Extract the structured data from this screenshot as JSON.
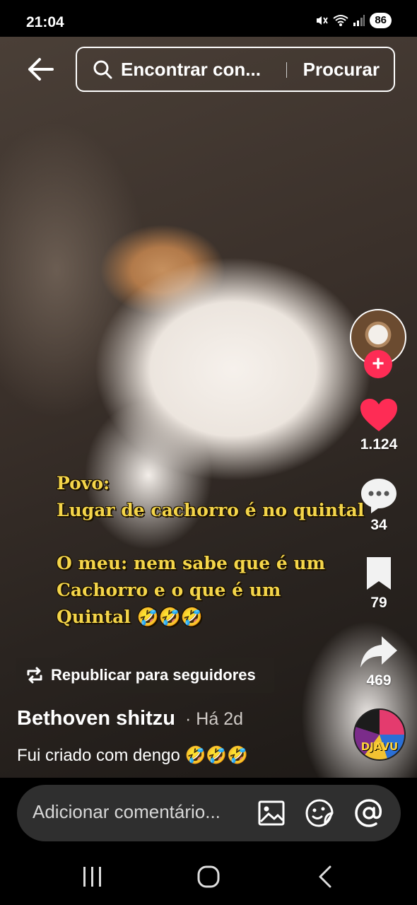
{
  "status": {
    "time": "21:04",
    "battery": "86"
  },
  "search": {
    "query": "Encontrar con...",
    "submit_label": "Procurar"
  },
  "overlay_lines": [
    "Povo:",
    "Lugar de cachorro é no quintal",
    "",
    "O meu: nem sabe que é um",
    "Cachorro e o que é um",
    "Quintal 🤣🤣🤣"
  ],
  "actions": {
    "likes": "1.124",
    "comments": "34",
    "saves": "79",
    "shares": "469"
  },
  "repost": {
    "label": "Republicar para seguidores"
  },
  "post": {
    "author": "Bethoven shitzu",
    "time": "· Há 2d",
    "caption": "Fui criado com dengo 🤣🤣🤣"
  },
  "music": {
    "disc_text": "DJAVU"
  },
  "comment": {
    "placeholder": "Adicionar comentário..."
  },
  "colors": {
    "like_red": "#fe2c55",
    "overlay_yellow": "#f4d54a",
    "comment_bar_bg": "#2f2f2f"
  },
  "icons": [
    "back-arrow-icon",
    "search-icon",
    "heart-icon",
    "comment-icon",
    "bookmark-icon",
    "share-icon",
    "repost-icon",
    "image-icon",
    "emoji-sticker-icon",
    "mention-icon",
    "recents-icon",
    "home-icon",
    "back-icon"
  ]
}
